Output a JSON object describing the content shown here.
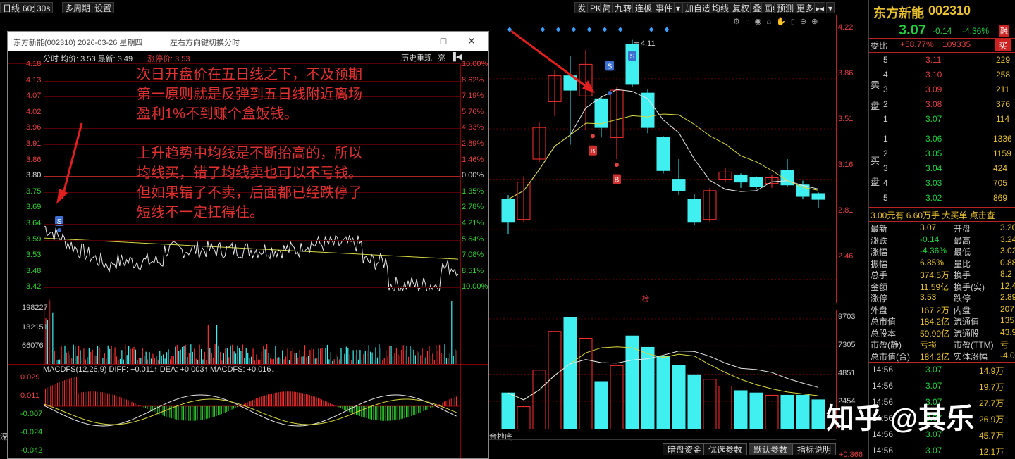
{
  "toolbar": {
    "left": [
      "日线",
      "60分",
      "30s",
      "多周期",
      "设置"
    ],
    "right": [
      "发",
      "PK",
      "简",
      "九转",
      "连板",
      "事件",
      "加自选",
      "均线",
      "复权",
      "叠",
      "画线",
      "预测",
      "更多"
    ]
  },
  "main_chart": {
    "price_labels": [
      "4.22",
      "3.86",
      "3.51",
      "3.16",
      "2.81",
      "2.46"
    ],
    "high_annotation": "4.11",
    "mid_label": "榜",
    "buy_marker": "B",
    "sell_marker": "S",
    "candles": [
      {
        "o": 2.86,
        "c": 3.02,
        "h": 3.05,
        "l": 2.78,
        "up": false
      },
      {
        "o": 2.88,
        "c": 3.14,
        "h": 3.18,
        "l": 2.86,
        "up": true
      },
      {
        "o": 3.3,
        "c": 3.52,
        "h": 3.56,
        "l": 3.28,
        "up": true
      },
      {
        "o": 3.7,
        "c": 3.88,
        "h": 3.92,
        "l": 3.6,
        "up": true
      },
      {
        "o": 3.88,
        "c": 3.78,
        "h": 4.02,
        "l": 3.4,
        "up": false
      },
      {
        "o": 3.74,
        "c": 3.96,
        "h": 4.06,
        "l": 3.5,
        "up": true
      },
      {
        "o": 3.72,
        "c": 3.52,
        "h": 3.74,
        "l": 3.45,
        "up": false
      },
      {
        "o": 3.45,
        "c": 3.78,
        "h": 3.8,
        "l": 3.3,
        "up": true
      },
      {
        "o": 4.1,
        "c": 3.82,
        "h": 4.13,
        "l": 3.8,
        "up": false
      },
      {
        "o": 3.76,
        "c": 3.52,
        "h": 3.79,
        "l": 3.48,
        "up": false
      },
      {
        "o": 3.45,
        "c": 3.22,
        "h": 3.46,
        "l": 3.2,
        "up": false
      },
      {
        "o": 3.16,
        "c": 3.08,
        "h": 3.3,
        "l": 3.05,
        "up": false
      },
      {
        "o": 3.02,
        "c": 2.86,
        "h": 3.06,
        "l": 2.84,
        "up": false
      },
      {
        "o": 2.88,
        "c": 3.08,
        "h": 3.1,
        "l": 2.86,
        "up": true
      },
      {
        "o": 3.16,
        "c": 3.21,
        "h": 3.24,
        "l": 3.14,
        "up": true
      },
      {
        "o": 3.19,
        "c": 3.14,
        "h": 3.2,
        "l": 3.1,
        "up": false
      },
      {
        "o": 3.17,
        "c": 3.11,
        "h": 3.18,
        "l": 3.09,
        "up": false
      },
      {
        "o": 3.13,
        "c": 3.17,
        "h": 3.19,
        "l": 3.1,
        "up": true
      },
      {
        "o": 3.22,
        "c": 3.12,
        "h": 3.3,
        "l": 3.11,
        "up": false
      },
      {
        "o": 3.12,
        "c": 3.04,
        "h": 3.15,
        "l": 3.02,
        "up": false
      },
      {
        "o": 3.06,
        "c": 3.02,
        "h": 3.07,
        "l": 2.96,
        "up": false
      }
    ],
    "volume": [
      3200,
      2000,
      5200,
      8600,
      9800,
      8000,
      4200,
      5600,
      8200,
      7200,
      6400,
      5600,
      4800,
      4400,
      3800,
      3400,
      3200,
      3000,
      3000,
      3000,
      2600
    ],
    "vol_labels": [
      "9703",
      "7305",
      "4851",
      "2454"
    ],
    "bottom_right_value": "+0.366",
    "bottom_left_label": "金抄底"
  },
  "popup": {
    "title": "东方新能(002310)  2026-03-26 星期四",
    "hint": "左右方向键切换分时",
    "toolbar_text": "分时  均价: 3.53  最新: 3.49",
    "limit_down": "涨停价: 3.53",
    "history": "历史重现",
    "bright": "亮",
    "left_axis": [
      "4.18",
      "4.13",
      "4.07",
      "4.02",
      "3.96",
      "3.91",
      "3.86",
      "3.80",
      "3.75",
      "3.69",
      "3.64",
      "3.59",
      "3.53",
      "3.48",
      "3.42"
    ],
    "right_axis": [
      "10.00%",
      "8.62%",
      "7.19%",
      "5.76%",
      "4.33%",
      "2.89%",
      "1.46%",
      "0.00%",
      "1.35%",
      "2.78%",
      "4.21%",
      "5.64%",
      "7.08%",
      "8.51%",
      "10.00%"
    ],
    "vol_axis": [
      "198227",
      "132151",
      "66076"
    ],
    "macd_header": "MACDFS(12,26,9)  DIFF: +0.011↑  DEA: +0.003↑  MACDFS: +0.016↓",
    "macd_axis": [
      "0.029",
      "0.011",
      "-0.007",
      "-0.024",
      "-0.042"
    ],
    "annotations": [
      "次日开盘价在五日线之下，不及预期",
      "第一原则就是反弹到五日线附近离场",
      "盈利1%不到赚个盒饭钱。",
      "",
      "上升趋势中均线是不断抬高的，所以",
      "均线买，错了均线卖也可以不亏钱。",
      "但如果错了不卖，后面都已经跌停了",
      "短线不一定扛得住。"
    ],
    "sell_marker": "S"
  },
  "right_panel": {
    "stock_name": "东方新能",
    "stock_code": "002310",
    "price": "3.07",
    "change": "-0.14",
    "change_pct": "-4.36%",
    "margin_tag": "融",
    "weibi_label": "委比",
    "weibi_value": "+58.77%",
    "weibi_count": "109335",
    "sell_tag": "买",
    "sell_label": "卖盘",
    "buy_label": "买盘",
    "asks": [
      {
        "n": "5",
        "p": "3.11",
        "v": "229"
      },
      {
        "n": "4",
        "p": "3.10",
        "v": "258"
      },
      {
        "n": "3",
        "p": "3.09",
        "v": "211"
      },
      {
        "n": "2",
        "p": "3.08",
        "v": "376"
      },
      {
        "n": "1",
        "p": "3.07",
        "v": "114"
      }
    ],
    "bids": [
      {
        "n": "1",
        "p": "3.06",
        "v": "1336"
      },
      {
        "n": "2",
        "p": "3.05",
        "v": "1159"
      },
      {
        "n": "3",
        "p": "3.04",
        "v": "424"
      },
      {
        "n": "4",
        "p": "3.03",
        "v": "705"
      },
      {
        "n": "5",
        "p": "3.02",
        "v": "869"
      }
    ],
    "big_order": "3.00元有 6.60万手 大买单 点击查",
    "stats": [
      [
        "最新",
        "3.07",
        "开盘",
        "3.20"
      ],
      [
        "涨跌",
        "-0.14",
        "最高",
        "3.24"
      ],
      [
        "涨幅",
        "-4.36%",
        "最低",
        "3.02"
      ],
      [
        "振幅",
        "6.85%",
        "量比",
        "0.88"
      ],
      [
        "总手",
        "374.5万",
        "换手",
        "8.2"
      ],
      [
        "金额",
        "11.59亿",
        "换手(实)",
        "12.4"
      ],
      [
        "涨停",
        "3.53",
        "跌停",
        "2.89"
      ],
      [
        "外盘",
        "167.2万",
        "内盘",
        "207.3"
      ],
      [
        "总市值",
        "184.2亿",
        "流通值",
        "135.7"
      ],
      [
        "总股本",
        "59.99亿",
        "流通股",
        "43.9"
      ],
      [
        "市盈(静)",
        "亏损",
        "市盈(TTM)",
        "亏"
      ],
      [
        "总市值(合)",
        "184.2亿",
        "实体涨幅",
        "-4.0"
      ]
    ],
    "ticks": [
      [
        "14:56",
        "3.07",
        "14.9万"
      ],
      [
        "14:56",
        "3.07",
        "19.7万"
      ],
      [
        "14:56",
        "3.07",
        "27.7万"
      ],
      [
        "14:56",
        "3.07",
        "26.9万"
      ],
      [
        "14:56",
        "3.07",
        "45.7万"
      ],
      [
        "14:56",
        "3.07",
        "12.1万"
      ]
    ]
  },
  "bottom_tabs": [
    "暗盘资金",
    "优选参数",
    "默认参数",
    "指标说明"
  ],
  "watermark": "知乎 @其乐",
  "left_edge": "深"
}
